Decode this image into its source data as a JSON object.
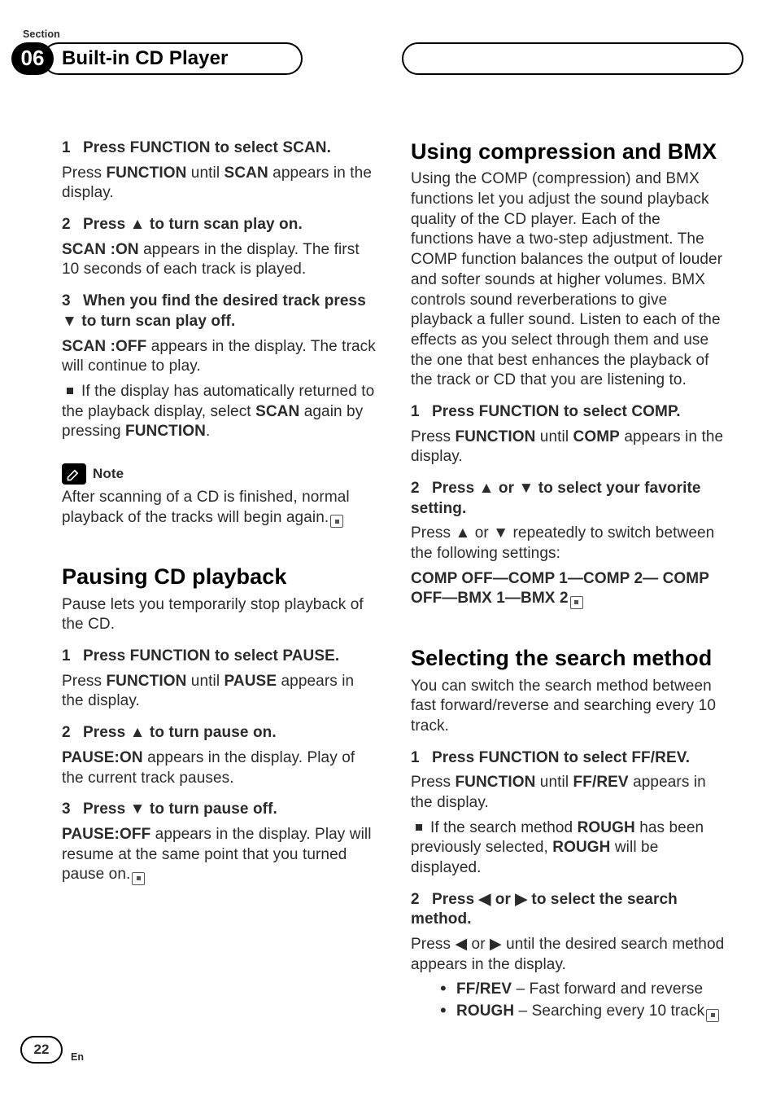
{
  "header": {
    "section_label": "Section",
    "section_number": "06",
    "title": "Built-in CD Player"
  },
  "left": {
    "steps_scan": {
      "s1": {
        "num": "1",
        "head": "Press FUNCTION to select SCAN.",
        "body_a": "Press ",
        "body_b": "FUNCTION",
        "body_c": " until ",
        "body_d": "SCAN",
        "body_e": " appears in the display."
      },
      "s2": {
        "num": "2",
        "head": "Press ▲ to turn scan play on.",
        "body_a": "SCAN :ON",
        "body_b": " appears in the display. The first 10 seconds of each track is played."
      },
      "s3": {
        "num": "3",
        "head_a": "When you find the desired track press ▼ to turn scan play off.",
        "body_a": "SCAN :OFF",
        "body_b": " appears in the display. The track will continue to play.",
        "bullet_a": "If the display has automatically returned to the playback display, select ",
        "bullet_b": "SCAN",
        "bullet_c": " again by pressing ",
        "bullet_d": "FUNCTION",
        "bullet_e": "."
      }
    },
    "note_label": "Note",
    "note_body": "After scanning of a CD is finished, normal playback of the tracks will begin again.",
    "pause_title": "Pausing CD playback",
    "pause_intro": "Pause lets you temporarily stop playback of the CD.",
    "pause_steps": {
      "s1": {
        "num": "1",
        "head": "Press FUNCTION to select PAUSE.",
        "body_a": "Press ",
        "body_b": "FUNCTION",
        "body_c": " until ",
        "body_d": "PAUSE",
        "body_e": " appears in the display."
      },
      "s2": {
        "num": "2",
        "head": "Press ▲ to turn pause on.",
        "body_a": "PAUSE:ON",
        "body_b": " appears in the display. Play of the current track pauses."
      },
      "s3": {
        "num": "3",
        "head": "Press ▼ to turn pause off.",
        "body_a": "PAUSE:OFF",
        "body_b": " appears in the display. Play will resume at the same point that you turned pause on."
      }
    }
  },
  "right": {
    "comp_title": "Using compression and BMX",
    "comp_intro": "Using the COMP (compression) and BMX functions let you adjust the sound playback quality of the CD player. Each of the functions have a two-step adjustment. The COMP function balances the output of louder and softer sounds at higher volumes. BMX controls sound reverberations to give playback a fuller sound. Listen to each of the effects as you select through them and use the one that best enhances the playback of the track or CD that you are listening to.",
    "comp_steps": {
      "s1": {
        "num": "1",
        "head": "Press FUNCTION to select COMP.",
        "body_a": "Press ",
        "body_b": "FUNCTION",
        "body_c": " until ",
        "body_d": "COMP",
        "body_e": " appears in the display."
      },
      "s2": {
        "num": "2",
        "head": "Press ▲ or ▼ to select your favorite setting.",
        "body": "Press ▲ or ▼ repeatedly to switch between the following settings:",
        "seq": "COMP OFF—COMP 1—COMP 2— COMP OFF—BMX 1—BMX 2"
      }
    },
    "search_title": "Selecting the search method",
    "search_intro": "You can switch the search method between fast forward/reverse and searching every 10 track.",
    "search_steps": {
      "s1": {
        "num": "1",
        "head": "Press FUNCTION to select FF/REV.",
        "body_a": "Press ",
        "body_b": "FUNCTION",
        "body_c": " until ",
        "body_d": "FF/REV",
        "body_e": " appears in the display.",
        "bullet_a": "If the search method ",
        "bullet_b": "ROUGH",
        "bullet_c": " has been previously selected, ",
        "bullet_d": "ROUGH",
        "bullet_e": " will be displayed."
      },
      "s2": {
        "num": "2",
        "head": "Press ◀ or ▶ to select the search method.",
        "body": "Press ◀ or ▶ until the desired search method appears in the display.",
        "li1_a": "FF/REV",
        "li1_b": " – Fast forward and reverse",
        "li2_a": "ROUGH",
        "li2_b": " – Searching every 10 track"
      }
    }
  },
  "footer": {
    "page": "22",
    "lang": "En"
  }
}
